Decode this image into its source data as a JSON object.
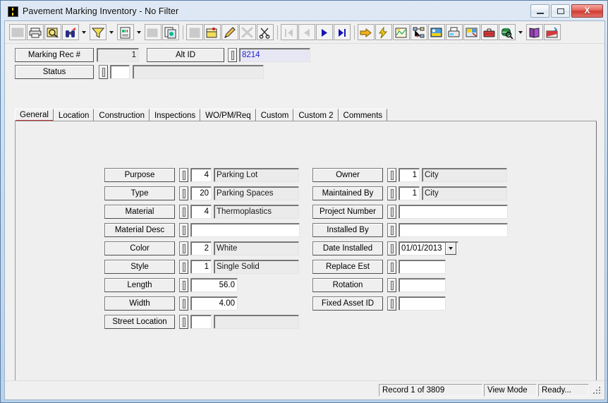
{
  "window": {
    "title": "Pavement Marking Inventory - No Filter",
    "app_icon": "road-marking-icon",
    "minimize_label": "Minimize",
    "maximize_label": "Maximize",
    "close_label": "X"
  },
  "toolbar": {
    "groups": [
      {
        "buttons": [
          {
            "name": "grid-view-icon",
            "label": "Grid View",
            "disabled": true,
            "dropdown": false
          },
          {
            "name": "print-icon",
            "label": "Print",
            "disabled": false,
            "dropdown": false
          },
          {
            "name": "print-preview-icon",
            "label": "Print Preview",
            "disabled": false,
            "dropdown": false
          },
          {
            "name": "find-binoculars-icon",
            "label": "Find",
            "disabled": false,
            "dropdown": true
          },
          {
            "name": "filter-funnel-icon",
            "label": "Filter",
            "disabled": false,
            "dropdown": true
          },
          {
            "name": "report-icon",
            "label": "Report",
            "disabled": false,
            "dropdown": true
          },
          {
            "name": "form-design-icon",
            "label": "Form Design",
            "disabled": true,
            "dropdown": false
          },
          {
            "name": "copy-record-icon",
            "label": "Copy Record",
            "disabled": false,
            "dropdown": false
          }
        ]
      },
      {
        "buttons": [
          {
            "name": "save-icon",
            "label": "Save",
            "disabled": true,
            "dropdown": false
          },
          {
            "name": "add-record-icon",
            "label": "Add Record",
            "disabled": false,
            "dropdown": false
          },
          {
            "name": "edit-pencil-icon",
            "label": "Edit",
            "disabled": false,
            "dropdown": false
          },
          {
            "name": "delete-x-icon",
            "label": "Delete",
            "disabled": true,
            "dropdown": false
          },
          {
            "name": "cut-scissors-icon",
            "label": "Cut",
            "disabled": false,
            "dropdown": false
          }
        ]
      },
      {
        "buttons": [
          {
            "name": "first-record-icon",
            "label": "First Record",
            "disabled": true,
            "dropdown": false
          },
          {
            "name": "previous-record-icon",
            "label": "Previous Record",
            "disabled": true,
            "dropdown": false
          },
          {
            "name": "next-record-icon",
            "label": "Next Record",
            "disabled": false,
            "dropdown": false
          },
          {
            "name": "last-record-icon",
            "label": "Last Record",
            "disabled": false,
            "dropdown": false
          }
        ]
      },
      {
        "buttons": [
          {
            "name": "goto-arrow-icon",
            "label": "Go To",
            "disabled": false,
            "dropdown": false
          },
          {
            "name": "lightning-action-icon",
            "label": "Quick Action",
            "disabled": false,
            "dropdown": false
          },
          {
            "name": "map-layers-icon",
            "label": "Map",
            "disabled": false,
            "dropdown": false
          },
          {
            "name": "tree-structure-icon",
            "label": "Structure",
            "disabled": false,
            "dropdown": false
          },
          {
            "name": "image-attach-icon",
            "label": "Images",
            "disabled": false,
            "dropdown": false
          },
          {
            "name": "fax-icon",
            "label": "Fax",
            "disabled": false,
            "dropdown": false
          },
          {
            "name": "documents-icon",
            "label": "Documents",
            "disabled": false,
            "dropdown": false
          },
          {
            "name": "toolbox-icon",
            "label": "Toolbox",
            "disabled": false,
            "dropdown": false
          },
          {
            "name": "globe-search-icon",
            "label": "Web Search",
            "disabled": false,
            "dropdown": true
          },
          {
            "name": "help-book-icon",
            "label": "Help",
            "disabled": false,
            "dropdown": false
          },
          {
            "name": "exit-icon",
            "label": "Exit",
            "disabled": false,
            "dropdown": false
          }
        ]
      }
    ]
  },
  "header": {
    "marking_rec_label": "Marking Rec #",
    "marking_rec_value": "1",
    "alt_id_label": "Alt ID",
    "alt_id_value": "8214",
    "status_label": "Status",
    "status_code": "",
    "status_desc": ""
  },
  "tabs": [
    {
      "label": "General",
      "active": true
    },
    {
      "label": "Location",
      "active": false
    },
    {
      "label": "Construction",
      "active": false
    },
    {
      "label": "Inspections",
      "active": false
    },
    {
      "label": "WO/PM/Req",
      "active": false
    },
    {
      "label": "Custom",
      "active": false
    },
    {
      "label": "Custom 2",
      "active": false
    },
    {
      "label": "Comments",
      "active": false
    }
  ],
  "general": {
    "left_fields": [
      {
        "label": "Purpose",
        "code": "4",
        "desc": "Parking Lot",
        "has_code": true,
        "desc_readonly": true,
        "wide": false
      },
      {
        "label": "Type",
        "code": "20",
        "desc": "Parking Spaces",
        "has_code": true,
        "desc_readonly": true,
        "wide": false
      },
      {
        "label": "Material",
        "code": "4",
        "desc": "Thermoplastics",
        "has_code": true,
        "desc_readonly": true,
        "wide": false
      },
      {
        "label": "Material Desc",
        "code": "",
        "desc": "",
        "has_code": false,
        "desc_readonly": false,
        "wide": true
      },
      {
        "label": "Color",
        "code": "2",
        "desc": "White",
        "has_code": true,
        "desc_readonly": true,
        "wide": false
      },
      {
        "label": "Style",
        "code": "1",
        "desc": "Single Solid",
        "has_code": true,
        "desc_readonly": true,
        "wide": false
      },
      {
        "label": "Length",
        "code": "56.0",
        "desc": "",
        "has_code": false,
        "desc_readonly": false,
        "wide": false,
        "numeric_only": true
      },
      {
        "label": "Width",
        "code": "4.00",
        "desc": "",
        "has_code": false,
        "desc_readonly": false,
        "wide": false,
        "numeric_only": true
      },
      {
        "label": "Street Location",
        "code": "",
        "desc": "",
        "has_code": true,
        "desc_readonly": true,
        "wide": false
      }
    ],
    "right_fields": [
      {
        "label": "Owner",
        "code": "1",
        "desc": "City",
        "has_code": true,
        "desc_readonly": true,
        "wide": false
      },
      {
        "label": "Maintained By",
        "code": "1",
        "desc": "City",
        "has_code": true,
        "desc_readonly": true,
        "wide": false
      },
      {
        "label": "Project Number",
        "code": "",
        "desc": "",
        "has_code": false,
        "desc_readonly": false,
        "wide": true
      },
      {
        "label": "Installed By",
        "code": "",
        "desc": "",
        "has_code": false,
        "desc_readonly": false,
        "wide": true
      },
      {
        "label": "Date Installed",
        "code": "01/01/2013",
        "desc": "",
        "has_code": false,
        "desc_readonly": false,
        "wide": false,
        "date": true
      },
      {
        "label": "Replace Est",
        "code": "",
        "desc": "",
        "has_code": false,
        "desc_readonly": false,
        "wide": false,
        "numeric_only": true
      },
      {
        "label": "Rotation",
        "code": "",
        "desc": "",
        "has_code": false,
        "desc_readonly": false,
        "wide": false,
        "numeric_only": true
      },
      {
        "label": "Fixed Asset ID",
        "code": "",
        "desc": "",
        "has_code": false,
        "desc_readonly": false,
        "wide": false,
        "numeric_only": true
      }
    ]
  },
  "statusbar": {
    "record_position": "Record 1 of 3809",
    "mode": "View Mode",
    "state": "Ready..."
  },
  "colors": {
    "selected_field_bg": "#e7e7f4",
    "selected_field_text": "#2222cc",
    "active_tab_underline": "#b03030",
    "panel_bg": "#efefef",
    "window_frame": "#b9d1ea"
  }
}
